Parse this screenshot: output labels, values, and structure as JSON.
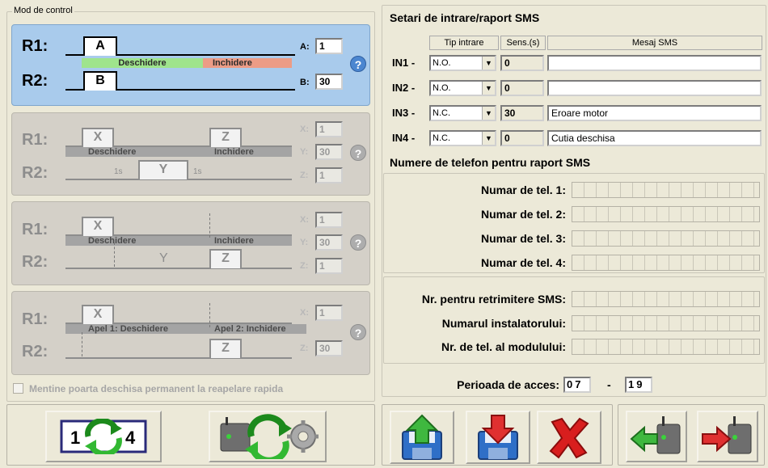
{
  "control": {
    "title": "Mod de control",
    "r1": "R1:",
    "r2": "R2:",
    "panel1": {
      "a": "A",
      "b": "B",
      "open": "Deschidere",
      "close": "Inchidere",
      "a_label": "A:",
      "a_value": "1",
      "b_label": "B:",
      "b_value": "30"
    },
    "panel2": {
      "x": "X",
      "z": "Z",
      "y": "Y",
      "open": "Deschidere",
      "close": "Inchidere",
      "tick1": "1s",
      "tick2": "1s",
      "x_label": "X:",
      "x_value": "1",
      "y_label": "Y:",
      "y_value": "30",
      "z_label": "Z:",
      "z_value": "1"
    },
    "panel3": {
      "x": "X",
      "z": "Z",
      "y": "Y",
      "open": "Deschidere",
      "close": "Inchidere",
      "x_label": "X:",
      "x_value": "1",
      "y_label": "Y:",
      "y_value": "30",
      "z_label": "Z:",
      "z_value": "1"
    },
    "panel4": {
      "x": "X",
      "z": "Z",
      "open": "Apel 1: Deschidere",
      "close": "Apel 2: Inchidere",
      "x_label": "X:",
      "x_value": "1",
      "z_label": "Z:",
      "z_value": "30"
    },
    "help": "?",
    "checkbox_label": "Mentine poarta deschisa permanent la reapelare rapida"
  },
  "sms": {
    "title": "Setari de intrare/raport SMS",
    "col_type": "Tip intrare",
    "col_sens": "Sens.(s)",
    "col_msg": "Mesaj SMS",
    "rows": [
      {
        "label": "IN1 -",
        "type": "N.O.",
        "sens": "0",
        "msg": ""
      },
      {
        "label": "IN2 -",
        "type": "N.O.",
        "sens": "0",
        "msg": ""
      },
      {
        "label": "IN3 -",
        "type": "N.C.",
        "sens": "30",
        "msg": "Eroare motor"
      },
      {
        "label": "IN4 -",
        "type": "N.C.",
        "sens": "0",
        "msg": "Cutia deschisa"
      }
    ]
  },
  "phones": {
    "title": "Numere de telefon pentru raport SMS",
    "tel1": "Numar de tel. 1:",
    "tel2": "Numar de tel. 2:",
    "tel3": "Numar de tel. 3:",
    "tel4": "Numar de tel. 4:",
    "resend": "Nr. pentru retrimitere SMS:",
    "installer": "Numarul instalatorului:",
    "module": "Nr. de tel. al modulului:"
  },
  "access": {
    "label": "Perioada de acces:",
    "from": "07",
    "sep": "-",
    "to": "19"
  },
  "toolbar": {
    "order_text_1": "1",
    "order_text_4": "4",
    "icons": [
      "reorder-icon",
      "module-sync-icon",
      "save-upload-icon",
      "save-download-icon",
      "delete-icon",
      "read-from-module-icon",
      "write-to-module-icon"
    ]
  }
}
